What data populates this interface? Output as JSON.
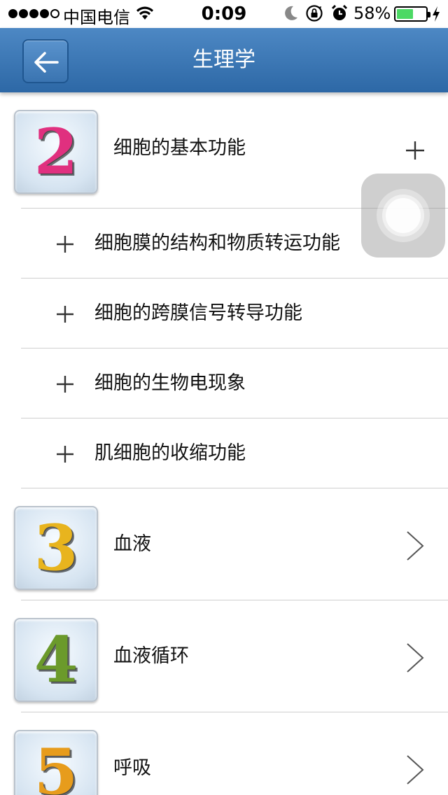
{
  "status_bar": {
    "signal_icon": "signal-dots-icon",
    "signal_bars": 4,
    "carrier": "中国电信",
    "time": "0:09",
    "battery_percent": "58%",
    "battery_level": 0.58,
    "battery_color": "#4cd964"
  },
  "nav": {
    "title": "生理学",
    "back_icon": "back-arrow-icon",
    "bar_color": "#3a76b5"
  },
  "chapters": [
    {
      "number": "2",
      "number_color": "#e0307f",
      "title": "细胞的基本功能",
      "expanded": true,
      "indicator_icon": "plus-icon",
      "sections": [
        "细胞膜的结构和物质转运功能",
        "细胞的跨膜信号转导功能",
        "细胞的生物电现象",
        "肌细胞的收缩功能"
      ]
    },
    {
      "number": "3",
      "number_color": "#e8b41e",
      "title": "血液",
      "expanded": false,
      "indicator_icon": "chevron-right-icon"
    },
    {
      "number": "4",
      "number_color": "#6b9a2b",
      "title": "血液循环",
      "expanded": false,
      "indicator_icon": "chevron-right-icon"
    },
    {
      "number": "5",
      "number_color": "#e79c1c",
      "title": "呼吸",
      "expanded": false,
      "indicator_icon": "chevron-right-icon"
    }
  ],
  "assistive_touch_icon": "assistive-touch-icon"
}
